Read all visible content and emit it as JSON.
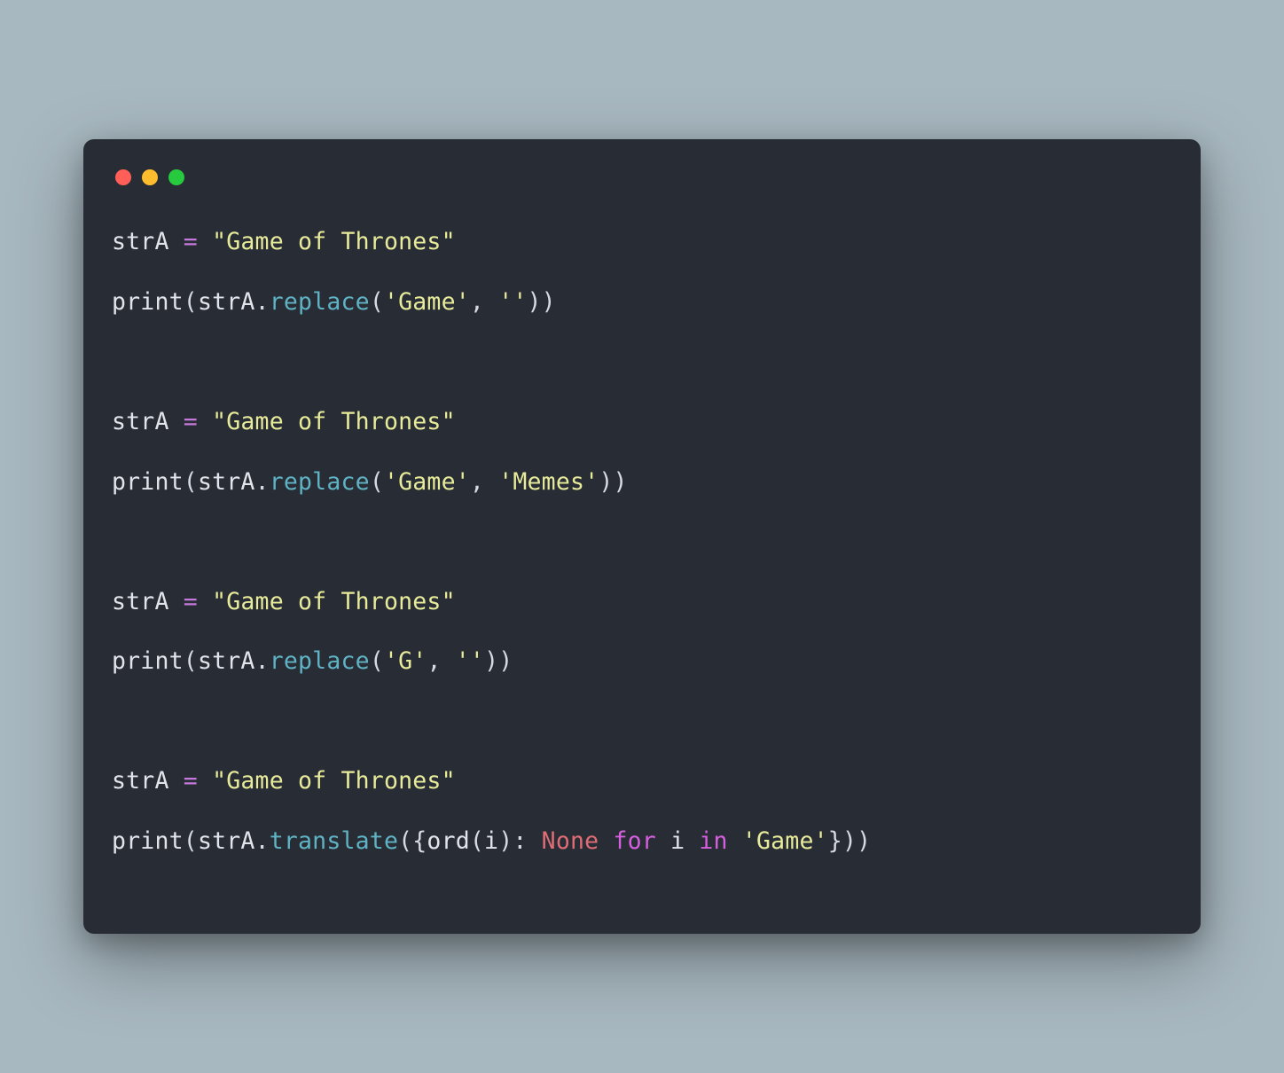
{
  "colors": {
    "bg_outer": "#a8b8c0",
    "bg_editor": "#282c34",
    "dot_red": "#ff5f56",
    "dot_yellow": "#ffbd2e",
    "dot_green": "#27c93f",
    "text_default": "#d7dae0",
    "text_string": "#e7eb9a",
    "text_method": "#5fb3c4",
    "text_keyword": "#d55fde",
    "text_constant": "#e06c75"
  },
  "code": {
    "lines": [
      [
        {
          "t": "strA ",
          "c": "var"
        },
        {
          "t": "=",
          "c": "op"
        },
        {
          "t": " ",
          "c": "var"
        },
        {
          "t": "\"Game of Thrones\"",
          "c": "str"
        }
      ],
      [
        {
          "t": "print",
          "c": "fn"
        },
        {
          "t": "(",
          "c": "punc"
        },
        {
          "t": "strA",
          "c": "var"
        },
        {
          "t": ".",
          "c": "punc"
        },
        {
          "t": "replace",
          "c": "method"
        },
        {
          "t": "(",
          "c": "punc"
        },
        {
          "t": "'Game'",
          "c": "str"
        },
        {
          "t": ", ",
          "c": "punc"
        },
        {
          "t": "''",
          "c": "str"
        },
        {
          "t": "))",
          "c": "punc"
        }
      ],
      [],
      [
        {
          "t": "strA ",
          "c": "var"
        },
        {
          "t": "=",
          "c": "op"
        },
        {
          "t": " ",
          "c": "var"
        },
        {
          "t": "\"Game of Thrones\"",
          "c": "str"
        }
      ],
      [
        {
          "t": "print",
          "c": "fn"
        },
        {
          "t": "(",
          "c": "punc"
        },
        {
          "t": "strA",
          "c": "var"
        },
        {
          "t": ".",
          "c": "punc"
        },
        {
          "t": "replace",
          "c": "method"
        },
        {
          "t": "(",
          "c": "punc"
        },
        {
          "t": "'Game'",
          "c": "str"
        },
        {
          "t": ", ",
          "c": "punc"
        },
        {
          "t": "'Memes'",
          "c": "str"
        },
        {
          "t": "))",
          "c": "punc"
        }
      ],
      [],
      [
        {
          "t": "strA ",
          "c": "var"
        },
        {
          "t": "=",
          "c": "op"
        },
        {
          "t": " ",
          "c": "var"
        },
        {
          "t": "\"Game of Thrones\"",
          "c": "str"
        }
      ],
      [
        {
          "t": "print",
          "c": "fn"
        },
        {
          "t": "(",
          "c": "punc"
        },
        {
          "t": "strA",
          "c": "var"
        },
        {
          "t": ".",
          "c": "punc"
        },
        {
          "t": "replace",
          "c": "method"
        },
        {
          "t": "(",
          "c": "punc"
        },
        {
          "t": "'G'",
          "c": "str"
        },
        {
          "t": ", ",
          "c": "punc"
        },
        {
          "t": "''",
          "c": "str"
        },
        {
          "t": "))",
          "c": "punc"
        }
      ],
      [],
      [
        {
          "t": "strA ",
          "c": "var"
        },
        {
          "t": "=",
          "c": "op"
        },
        {
          "t": " ",
          "c": "var"
        },
        {
          "t": "\"Game of Thrones\"",
          "c": "str"
        }
      ],
      [
        {
          "t": "print",
          "c": "fn"
        },
        {
          "t": "(",
          "c": "punc"
        },
        {
          "t": "strA",
          "c": "var"
        },
        {
          "t": ".",
          "c": "punc"
        },
        {
          "t": "translate",
          "c": "method"
        },
        {
          "t": "({",
          "c": "punc"
        },
        {
          "t": "ord",
          "c": "fn"
        },
        {
          "t": "(",
          "c": "punc"
        },
        {
          "t": "i",
          "c": "var"
        },
        {
          "t": "): ",
          "c": "punc"
        },
        {
          "t": "None",
          "c": "none"
        },
        {
          "t": " ",
          "c": "punc"
        },
        {
          "t": "for",
          "c": "kw"
        },
        {
          "t": " ",
          "c": "punc"
        },
        {
          "t": "i",
          "c": "var"
        },
        {
          "t": " ",
          "c": "punc"
        },
        {
          "t": "in",
          "c": "kw"
        },
        {
          "t": " ",
          "c": "punc"
        },
        {
          "t": "'Game'",
          "c": "str"
        },
        {
          "t": "}))",
          "c": "punc"
        }
      ]
    ]
  }
}
